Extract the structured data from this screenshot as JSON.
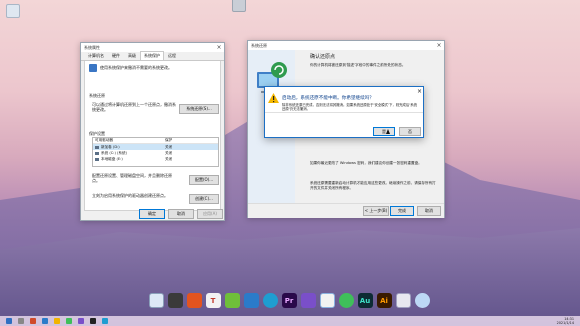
{
  "colors": {
    "accent": "#0078d7",
    "warning": "#f5b800",
    "selected_row": "#cce4f7"
  },
  "system_props": {
    "title": "系统属性",
    "tabs": [
      "计算机名",
      "硬件",
      "高级",
      "系统保护",
      "远程"
    ],
    "active_tab_index": 3,
    "intro": "使用系统保护来撤消不需要的系统更改。",
    "restore_header": "系统还原",
    "restore_desc": "可以通过将计算机还原到上一个还原点，撤消系统更改。",
    "restore_button": "系统还原(S)...",
    "settings_header": "保护设置",
    "columns": [
      "可用驱动器",
      "保护"
    ],
    "drives": [
      {
        "name": "新加卷 (D:)",
        "status": "关闭"
      },
      {
        "name": "系统 (C:) (系统)",
        "status": "关闭"
      },
      {
        "name": "本地磁盘 (E:)",
        "status": "关闭"
      }
    ],
    "configure_desc": "配置还原设置、管理磁盘空间，并且删除还原点。",
    "configure_button": "配置(O)...",
    "create_desc": "立刻为启用系统保护的驱动器创建还原点。",
    "create_button": "创建(C)...",
    "ok": "确定",
    "cancel": "取消",
    "apply": "应用(A)"
  },
  "restore_wizard": {
    "title": "系统还原",
    "heading": "确认还原点",
    "sub": "你的计算机将被还原到'描述'字段中的事件之前所处的状态。",
    "bottom_1": "如果你最近更改了 Windows 密码，我们建议你创建一张密码重置盘。",
    "bottom_2": "系统还原需要重新启动计算机才能应用这些更改。继续操作之前，请保存所有打开的文件并关闭所有程序。",
    "back": "< 上一步(B)",
    "finish": "完成",
    "cancel": "取消"
  },
  "message_box": {
    "title": "启动后，系统还原不能中断。你希望继续吗？",
    "body": "除非系统还原已完成，否则无法将其撤消。如果系统还原处于'安全模式'下，则完成后'系统还原'仍无法撤消。",
    "yes": "是",
    "no": "否"
  },
  "dock_icons": [
    "monitor-icon",
    "app-grid-icon",
    "office-icon",
    "text-icon",
    "stack-icon",
    "image-icon",
    "edge-icon",
    "premiere-icon",
    "photo-icon",
    "qq-icon",
    "wechat-icon",
    "audition-icon",
    "illustrator-icon",
    "browser-icon",
    "search-icon"
  ],
  "dock_letters": {
    "premiere": "Pr",
    "audition": "Au",
    "illustrator": "Ai"
  },
  "clock": {
    "time": "14:31",
    "date": "2021/1/14"
  }
}
